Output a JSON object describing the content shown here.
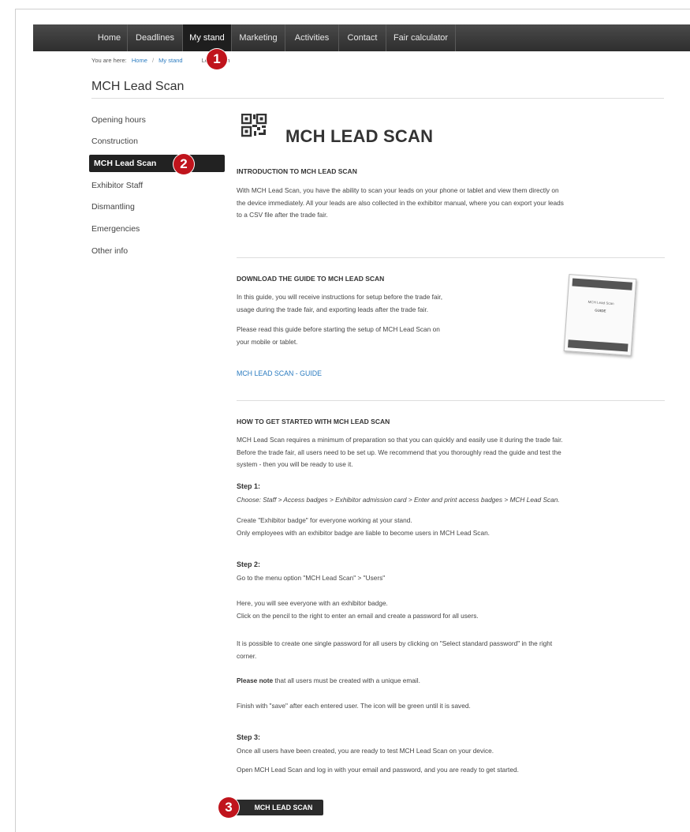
{
  "nav": {
    "items": [
      {
        "label": "Home"
      },
      {
        "label": "Deadlines"
      },
      {
        "label": "My stand"
      },
      {
        "label": "Marketing"
      },
      {
        "label": "Activities"
      },
      {
        "label": "Contact"
      },
      {
        "label": "Fair calculator"
      }
    ],
    "active": "My stand"
  },
  "breadcrumb": {
    "prefix": "You are here:",
    "items": [
      "Home",
      "My stand",
      "Lead Scan"
    ]
  },
  "page_title": "MCH Lead Scan",
  "sidebar": {
    "items": [
      {
        "label": "Opening hours"
      },
      {
        "label": "Construction"
      },
      {
        "label": "MCH Lead Scan"
      },
      {
        "label": "Exhibitor Staff"
      },
      {
        "label": "Dismantling"
      },
      {
        "label": "Emergencies"
      },
      {
        "label": "Other info"
      }
    ],
    "active": "MCH Lead Scan"
  },
  "badges": [
    "1",
    "2",
    "3"
  ],
  "main": {
    "heading": "MCH LEAD SCAN",
    "intro": {
      "heading": "INTRODUCTION TO MCH LEAD SCAN",
      "lines": [
        "With MCH Lead Scan, you have the ability to scan your leads on your phone or tablet and view them directly on",
        "the device immediately. All your leads are also collected in the exhibitor manual, where you can export your leads",
        "to a CSV file after the trade fair."
      ]
    },
    "guide": {
      "heading": "DOWNLOAD THE GUIDE TO MCH LEAD SCAN",
      "p1": [
        "In this guide, you will receive instructions for setup before the trade fair,",
        "usage during the trade fair, and exporting leads after the trade fair."
      ],
      "p2": [
        "Please read this guide before starting the setup of MCH Lead Scan on",
        "your mobile or tablet."
      ],
      "link": "MCH LEAD SCAN - GUIDE",
      "thumb_title": "MCH Lead Scan",
      "thumb_sub": "GUIDE"
    },
    "started": {
      "heading": "HOW TO GET STARTED WITH MCH LEAD SCAN",
      "lines": [
        "MCH Lead Scan requires a minimum of preparation so that you can quickly and easily use it during the trade fair.",
        "Before the trade fair, all users need to be set up. We recommend that you thoroughly read the guide and test the",
        "system - then you will be ready to use it."
      ],
      "step1": {
        "label": "Step 1:",
        "path": "Choose: Staff > Access badges > Exhibitor admission card > Enter and print access badges > MCH Lead Scan.",
        "l1": "Create \"Exhibitor badge\" for everyone working at your stand.",
        "l2": "Only employees with an exhibitor badge are liable to become users in MCH Lead Scan."
      },
      "step2": {
        "label": "Step 2:",
        "l1": "Go to the menu option \"MCH Lead Scan\" > \"Users\"",
        "l2": "Here, you will see everyone with an exhibitor badge.",
        "l3": "Click on the pencil to the right to enter an email and create a password for all users.",
        "l4": "It is possible to create one single password for all users by clicking on \"Select standard password\" in the right",
        "l5": "corner.",
        "note_bold": "Please note",
        "note_rest": " that all users must be created with a unique email.",
        "l6": "Finish with \"save\" after each entered user. The icon will be green until it is saved."
      },
      "step3": {
        "label": "Step 3:",
        "l1": "Once all users have been created, you are ready to test MCH Lead Scan on your device.",
        "l2": "Open MCH Lead Scan and log in with your email and password, and you are ready to get started."
      }
    },
    "cta_label": "MCH LEAD SCAN"
  }
}
